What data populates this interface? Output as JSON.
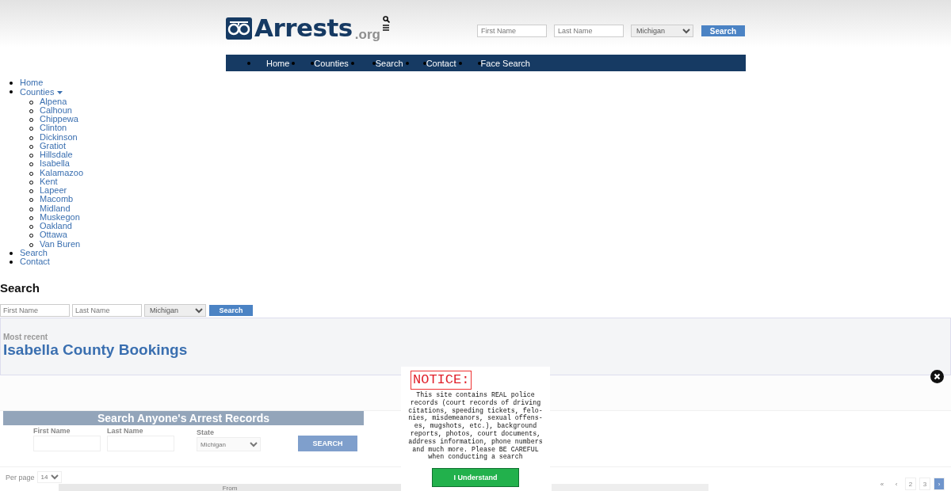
{
  "header": {
    "logo": {
      "name": "Arrests",
      "suffix": ".org"
    },
    "search": {
      "first_placeholder": "First Name",
      "last_placeholder": "Last Name",
      "state": "Michigan",
      "button": "Search"
    }
  },
  "nav": [
    "Home",
    "Counties",
    "Search",
    "Contact",
    "Face Search"
  ],
  "menu": [
    {
      "label": "Home"
    },
    {
      "label": "Counties",
      "expanded": true,
      "children": [
        {
          "label": "Alpena"
        },
        {
          "label": "Calhoun"
        },
        {
          "label": "Chippewa"
        },
        {
          "label": "Clinton"
        },
        {
          "label": "Dickinson"
        },
        {
          "label": "Gratiot"
        },
        {
          "label": "Hillsdale"
        },
        {
          "label": "Isabella"
        },
        {
          "label": "Kalamazoo"
        },
        {
          "label": "Kent"
        },
        {
          "label": "Lapeer"
        },
        {
          "label": "Macomb"
        },
        {
          "label": "Midland"
        },
        {
          "label": "Muskegon"
        },
        {
          "label": "Oakland"
        },
        {
          "label": "Ottawa"
        },
        {
          "label": "Van Buren"
        }
      ]
    },
    {
      "label": "Search"
    },
    {
      "label": "Contact"
    }
  ],
  "search_section": {
    "heading": "Search",
    "first_placeholder": "First Name",
    "last_placeholder": "Last Name",
    "state": "Michigan",
    "button": "Search"
  },
  "bookings": {
    "subtitle": "Most recent",
    "title": "Isabella County Bookings"
  },
  "records_search": {
    "title": "Search Anyone's Arrest Records",
    "fields": [
      {
        "kind": "text",
        "label": "First Name"
      },
      {
        "kind": "text",
        "label": "Last Name"
      },
      {
        "kind": "select",
        "label": "State",
        "value": "Michigan"
      }
    ],
    "button": "SEARCH"
  },
  "per_page": {
    "label": "Per page",
    "value": "14"
  },
  "table": {
    "columns": [
      "From"
    ]
  },
  "pagination": [
    {
      "label": "«",
      "selected": false
    },
    {
      "label": "‹",
      "selected": false
    },
    {
      "label": "2",
      "selected": false
    },
    {
      "label": "3",
      "selected": false
    },
    {
      "label": "›",
      "selected": true
    }
  ],
  "notice": {
    "title": "NOTICE:",
    "text": "This site contains REAL police\nrecords (court records of driving\ncitations, speeding tickets, felo-\nnies, misdemeanors, sexual offens-\nes, mugshots, etc.), background\nreports, photos, court documents,\naddress information, phone numbers\nand much more. Please BE CAREFUL\nwhen conducting a search",
    "button": "I Understand"
  }
}
